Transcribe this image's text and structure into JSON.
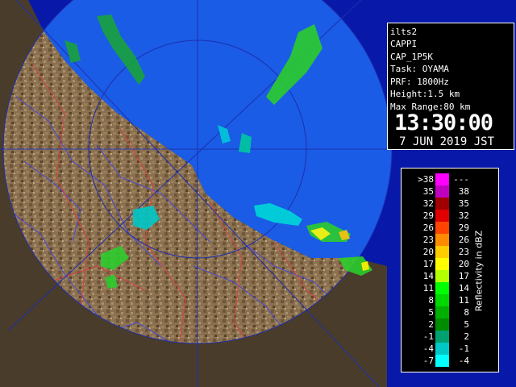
{
  "info": {
    "site": "ilts2",
    "product": "CAPPI",
    "product_code": "CAP_1P5K",
    "task": "Task: OYAMA",
    "prf": "PRF: 1800Hz",
    "height": "Height:1.5 km",
    "max_range": "Max Range:80 km",
    "time": "13:30:00",
    "date": "7 JUN 2019 JST"
  },
  "legend": {
    "unit": "Reflectivity in dBZ",
    "bins": [
      {
        "lo": ">38",
        "hi": "---",
        "color": "#ff00ff"
      },
      {
        "lo": "35",
        "hi": "38",
        "color": "#c000c0"
      },
      {
        "lo": "32",
        "hi": "35",
        "color": "#a00000"
      },
      {
        "lo": "29",
        "hi": "32",
        "color": "#e00000"
      },
      {
        "lo": "26",
        "hi": "29",
        "color": "#ff4400"
      },
      {
        "lo": "23",
        "hi": "26",
        "color": "#ff8c00"
      },
      {
        "lo": "20",
        "hi": "23",
        "color": "#ffcc00"
      },
      {
        "lo": "17",
        "hi": "20",
        "color": "#ffff00"
      },
      {
        "lo": "14",
        "hi": "17",
        "color": "#b4ff00"
      },
      {
        "lo": "11",
        "hi": "14",
        "color": "#00ff00"
      },
      {
        "lo": "8",
        "hi": "11",
        "color": "#00d800"
      },
      {
        "lo": "5",
        "hi": "8",
        "color": "#00b000"
      },
      {
        "lo": "2",
        "hi": "5",
        "color": "#008c00"
      },
      {
        "lo": "-1",
        "hi": "2",
        "color": "#00a070"
      },
      {
        "lo": "-4",
        "hi": "-1",
        "color": "#00c8c8"
      },
      {
        "lo": "-7",
        "hi": "-4",
        "color": "#00ffff"
      }
    ]
  }
}
